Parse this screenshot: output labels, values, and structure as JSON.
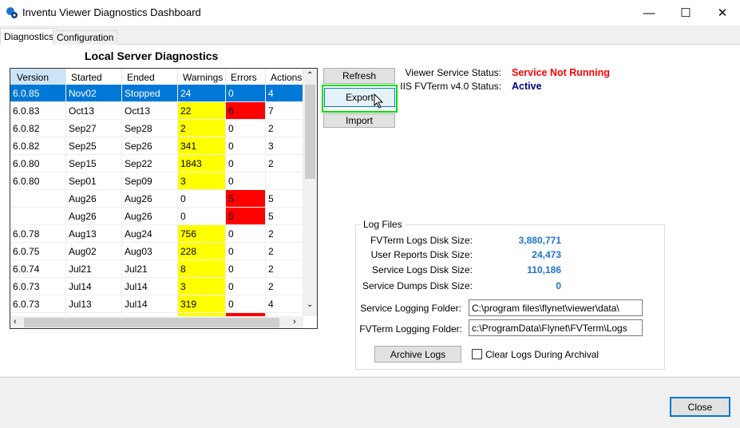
{
  "window": {
    "title": "Inventu Viewer Diagnostics Dashboard",
    "minimize": "—",
    "maximize": "☐",
    "close": "✕"
  },
  "tabs": [
    {
      "label": "Diagnostics",
      "active": true
    },
    {
      "label": "Configuration",
      "active": false
    }
  ],
  "heading": "Local Server Diagnostics",
  "grid": {
    "columns": [
      "Version",
      "Started",
      "Ended",
      "Warnings",
      "Errors",
      "Actions"
    ],
    "rows": [
      {
        "cells": [
          "6.0.85",
          "Nov02",
          "Stopped",
          "24",
          "0",
          "4"
        ],
        "selected": true
      },
      {
        "cells": [
          "6.0.83",
          "Oct13",
          "Oct13",
          "22",
          "6",
          "7"
        ],
        "warn": true,
        "err": true
      },
      {
        "cells": [
          "6.0.82",
          "Sep27",
          "Sep28",
          "2",
          "0",
          "2"
        ],
        "warn": true
      },
      {
        "cells": [
          "6.0.82",
          "Sep25",
          "Sep26",
          "341",
          "0",
          "3"
        ],
        "warn": true
      },
      {
        "cells": [
          "6.0.80",
          "Sep15",
          "Sep22",
          "1843",
          "0",
          "2"
        ],
        "warn": true
      },
      {
        "cells": [
          "6.0.80",
          "Sep01",
          "Sep09",
          "3",
          "0",
          ""
        ],
        "warn": true
      },
      {
        "cells": [
          "",
          "Aug26",
          "Aug26",
          "0",
          "5",
          "5"
        ],
        "err": true
      },
      {
        "cells": [
          "",
          "Aug26",
          "Aug26",
          "0",
          "5",
          "5"
        ],
        "err": true
      },
      {
        "cells": [
          "6.0.78",
          "Aug13",
          "Aug24",
          "756",
          "0",
          "2"
        ],
        "warn": true
      },
      {
        "cells": [
          "6.0.75",
          "Aug02",
          "Aug03",
          "228",
          "0",
          "2"
        ],
        "warn": true
      },
      {
        "cells": [
          "6.0.74",
          "Jul21",
          "Jul21",
          "8",
          "0",
          "2"
        ],
        "warn": true
      },
      {
        "cells": [
          "6.0.73",
          "Jul14",
          "Jul14",
          "3",
          "0",
          "2"
        ],
        "warn": true
      },
      {
        "cells": [
          "6.0.73",
          "Jul13",
          "Jul14",
          "319",
          "0",
          "4"
        ],
        "warn": true
      },
      {
        "cells": [
          "",
          "",
          "",
          "",
          "",
          ""
        ],
        "warn": true,
        "err": true
      }
    ]
  },
  "buttons": {
    "refresh": "Refresh",
    "export": "Export",
    "import": "Import",
    "archive": "Archive Logs",
    "close": "Close"
  },
  "status": {
    "viewer_label": "Viewer Service Status:",
    "viewer_value": "Service Not Running",
    "iis_label": "IIS FVTerm v4.0 Status:",
    "iis_value": "Active"
  },
  "log_files": {
    "title": "Log Files",
    "sizes": [
      {
        "label": "FVTerm Logs Disk Size:",
        "value": "3,880,771"
      },
      {
        "label": "User Reports Disk Size:",
        "value": "24,473"
      },
      {
        "label": "Service Logs Disk Size:",
        "value": "110,186"
      },
      {
        "label": "Service Dumps Disk Size:",
        "value": "0"
      }
    ],
    "service_folder_label": "Service Logging Folder:",
    "service_folder_value": "C:\\program files\\flynet\\viewer\\data\\",
    "fvterm_folder_label": "FVTerm Logging Folder:",
    "fvterm_folder_value": "c:\\ProgramData\\Flynet\\FVTerm\\Logs",
    "clear_logs_label": "Clear Logs During Archival",
    "clear_logs_checked": false
  },
  "colors": {
    "selected": "#0078d7",
    "warning": "#ffff00",
    "error": "#ff0000",
    "not_running": "#ff0000",
    "active": "#000080",
    "size_value": "#1e73d2",
    "export_highlight": "#00e000"
  }
}
